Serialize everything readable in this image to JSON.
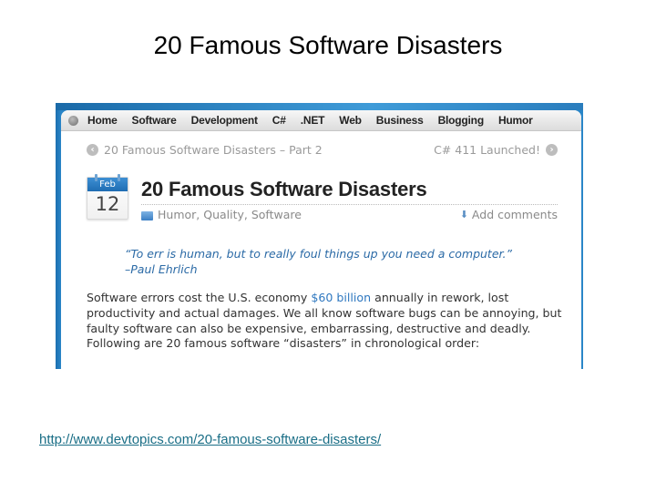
{
  "slide": {
    "title": "20 Famous Software Disasters",
    "source_url": "http://www.devtopics.com/20-famous-software-disasters/"
  },
  "screenshot": {
    "nav": {
      "items": [
        "Home",
        "Software",
        "Development",
        "C#",
        ".NET",
        "Web",
        "Business",
        "Blogging",
        "Humor"
      ]
    },
    "post_nav": {
      "prev_label": "20 Famous Software Disasters – Part 2",
      "next_label": "C# 411 Launched!",
      "prev_icon": "arrow-left-circle-icon",
      "next_icon": "arrow-right-circle-icon"
    },
    "date": {
      "month": "Feb",
      "day": "12"
    },
    "post_title": "20 Famous Software Disasters",
    "categories": "Humor, Quality, Software",
    "add_comments": "Add comments",
    "quote": "“To err is human, but to really foul things up you need a computer.”  –Paul Ehrlich",
    "body": {
      "before_link": "Software errors cost the U.S. economy ",
      "link_text": "$60 billion",
      "after_link": " annually in rework, lost productivity and actual damages.  We all know software bugs can be annoying, but faulty software can also be expensive, embarrassing, destructive and deadly.  Following are 20 famous software “disasters” in chronological order:"
    }
  }
}
